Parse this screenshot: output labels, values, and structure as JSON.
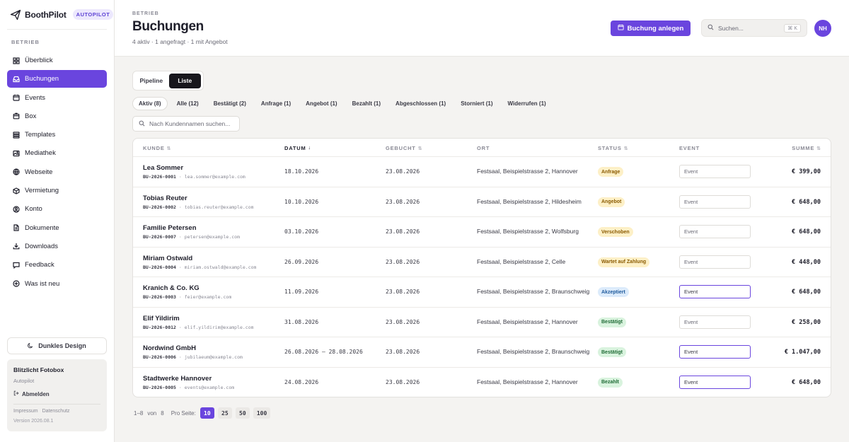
{
  "brand": {
    "name": "BoothPilot",
    "tag": "AUTOPILOT"
  },
  "sidebar": {
    "section": "BETRIEB",
    "items": [
      {
        "label": "Überblick",
        "icon": "grid-icon"
      },
      {
        "label": "Buchungen",
        "icon": "inbox-icon",
        "active": true
      },
      {
        "label": "Events",
        "icon": "calendar-icon"
      },
      {
        "label": "Box",
        "icon": "box-icon"
      },
      {
        "label": "Templates",
        "icon": "layers-icon"
      },
      {
        "label": "Mediathek",
        "icon": "image-icon"
      },
      {
        "label": "Webseite",
        "icon": "globe-icon"
      },
      {
        "label": "Vermietung",
        "icon": "package-icon"
      },
      {
        "label": "Konto",
        "icon": "user-icon"
      },
      {
        "label": "Dokumente",
        "icon": "document-icon"
      },
      {
        "label": "Downloads",
        "icon": "download-icon"
      },
      {
        "label": "Feedback",
        "icon": "message-icon"
      },
      {
        "label": "Was ist neu",
        "icon": "sparkle-icon"
      }
    ],
    "dark_mode_label": "Dunkles Design",
    "account": {
      "name": "Blitzlicht Fotobox",
      "plan": "Autopilot",
      "logout": "Abmelden",
      "impressum": "Impressum",
      "datenschutz": "Datenschutz",
      "version": "Version 2026.08.1"
    }
  },
  "header": {
    "crumb": "BETRIEB",
    "title": "Buchungen",
    "subtitle": "4 aktiv · 1 angefragt · 1 mit Angebot",
    "new_button": "Buchung anlegen",
    "search_placeholder": "Suchen...",
    "search_shortcut": "⌘ K",
    "avatar": "NH"
  },
  "view_toggle": {
    "pipeline": "Pipeline",
    "list": "Liste",
    "active": "list"
  },
  "filters": [
    {
      "label": "Aktiv (8)",
      "active": true
    },
    {
      "label": "Alle (12)"
    },
    {
      "label": "Bestätigt (2)"
    },
    {
      "label": "Anfrage (1)"
    },
    {
      "label": "Angebot (1)"
    },
    {
      "label": "Bezahlt (1)"
    },
    {
      "label": "Abgeschlossen (1)"
    },
    {
      "label": "Storniert (1)"
    },
    {
      "label": "Widerrufen (1)"
    }
  ],
  "name_search_placeholder": "Nach Kundennamen suchen...",
  "table": {
    "columns": {
      "kunde": "KUNDE",
      "datum": "DATUM",
      "gebucht": "GEBUCHT",
      "ort": "ORT",
      "status": "STATUS",
      "event": "EVENT",
      "summe": "SUMME"
    },
    "rows": [
      {
        "name": "Lea Sommer",
        "id": "BU-2026-0001",
        "email": "lea.sommer@example.com",
        "date": "18.10.2026",
        "booked": "23.08.2026",
        "place": "Festsaal, Beispielstrasse 2, Hannover",
        "status": "Anfrage",
        "status_bg": "#fdf0c7",
        "status_fg": "#8a5a00",
        "event": "Event",
        "event_set": false,
        "sum": "€ 399,00"
      },
      {
        "name": "Tobias Reuter",
        "id": "BU-2026-0002",
        "email": "tobias.reuter@example.com",
        "date": "10.10.2026",
        "booked": "23.08.2026",
        "place": "Festsaal, Beispielstrasse 2, Hildesheim",
        "status": "Angebot",
        "status_bg": "#fdf0c7",
        "status_fg": "#8a5a00",
        "event": "Event",
        "event_set": false,
        "sum": "€ 648,00"
      },
      {
        "name": "Familie Petersen",
        "id": "BU-2026-0007",
        "email": "petersen@example.com",
        "date": "03.10.2026",
        "booked": "23.08.2026",
        "place": "Festsaal, Beispielstrasse 2, Wolfsburg",
        "status": "Verschoben",
        "status_bg": "#fdf0c7",
        "status_fg": "#8a5a00",
        "event": "Event",
        "event_set": false,
        "sum": "€ 648,00"
      },
      {
        "name": "Miriam Ostwald",
        "id": "BU-2026-0004",
        "email": "miriam.ostwald@example.com",
        "date": "26.09.2026",
        "booked": "23.08.2026",
        "place": "Festsaal, Beispielstrasse 2, Celle",
        "status": "Wartet auf Zahlung",
        "status_bg": "#fdf0c7",
        "status_fg": "#8a5a00",
        "event": "Event",
        "event_set": false,
        "sum": "€ 448,00"
      },
      {
        "name": "Kranich & Co. KG",
        "id": "BU-2026-0003",
        "email": "feier@example.com",
        "date": "11.09.2026",
        "booked": "23.08.2026",
        "place": "Festsaal, Beispielstrasse 2, Braunschweig",
        "status": "Akzeptiert",
        "status_bg": "#dcebfb",
        "status_fg": "#1f5a9c",
        "event": "Event",
        "event_set": true,
        "sum": "€ 648,00"
      },
      {
        "name": "Elif Yildirim",
        "id": "BU-2026-0012",
        "email": "elif.yildirim@example.com",
        "date": "31.08.2026",
        "booked": "23.08.2026",
        "place": "Festsaal, Beispielstrasse 2, Hannover",
        "status": "Bestätigt",
        "status_bg": "#d9f3de",
        "status_fg": "#1f6b35",
        "event": "Event",
        "event_set": false,
        "sum": "€ 258,00"
      },
      {
        "name": "Nordwind GmbH",
        "id": "BU-2026-0006",
        "email": "jubilaeum@example.com",
        "date": "26.08.2026 – 28.08.2026",
        "booked": "23.08.2026",
        "place": "Festsaal, Beispielstrasse 2, Braunschweig",
        "status": "Bestätigt",
        "status_bg": "#d9f3de",
        "status_fg": "#1f6b35",
        "event": "Event",
        "event_set": true,
        "sum": "€ 1.047,00"
      },
      {
        "name": "Stadtwerke Hannover",
        "id": "BU-2026-0005",
        "email": "events@example.com",
        "date": "24.08.2026",
        "booked": "23.08.2026",
        "place": "Festsaal, Beispielstrasse 2, Hannover",
        "status": "Bezahlt",
        "status_bg": "#d9f3de",
        "status_fg": "#1f6b35",
        "event": "Event",
        "event_set": true,
        "sum": "€ 648,00"
      }
    ]
  },
  "pager": {
    "range": "1–8",
    "of": "von",
    "total": "8",
    "per_page_label": "Pro Seite:",
    "sizes": [
      "10",
      "25",
      "50",
      "100"
    ],
    "active_size": "10"
  },
  "colors": {
    "accent": "#6a45de",
    "background": "#f4f3f1"
  }
}
